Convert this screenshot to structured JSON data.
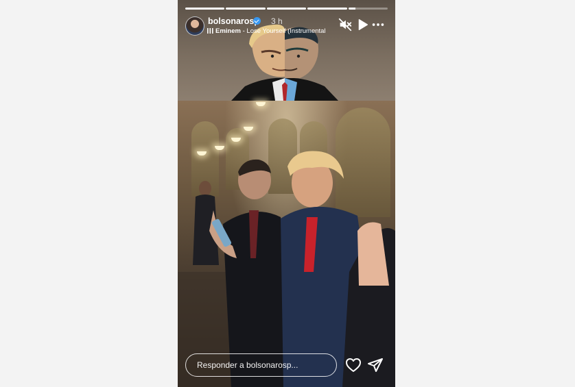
{
  "story": {
    "progress": [
      {
        "fill": 1.0
      },
      {
        "fill": 1.0
      },
      {
        "fill": 1.0
      },
      {
        "fill": 1.0
      },
      {
        "fill": 0.18
      }
    ],
    "user": {
      "username": "bolsonarosp",
      "verified": true,
      "time_ago": "3 h"
    },
    "music": {
      "artist": "Eminem",
      "separator": " - ",
      "track": "Lose Yourself (Instrumental)"
    },
    "controls": {
      "mute_icon": "speaker-muted-icon",
      "play_icon": "play-icon",
      "more_icon": "more-horizontal-icon"
    },
    "reply": {
      "placeholder": "Responder a bolsonarosp..."
    },
    "actions": {
      "like_icon": "heart-outline-icon",
      "share_icon": "send-icon"
    },
    "colors": {
      "page_background": "#f3f3f3",
      "verified_badge": "#3897f0",
      "text": "#ffffff"
    }
  }
}
